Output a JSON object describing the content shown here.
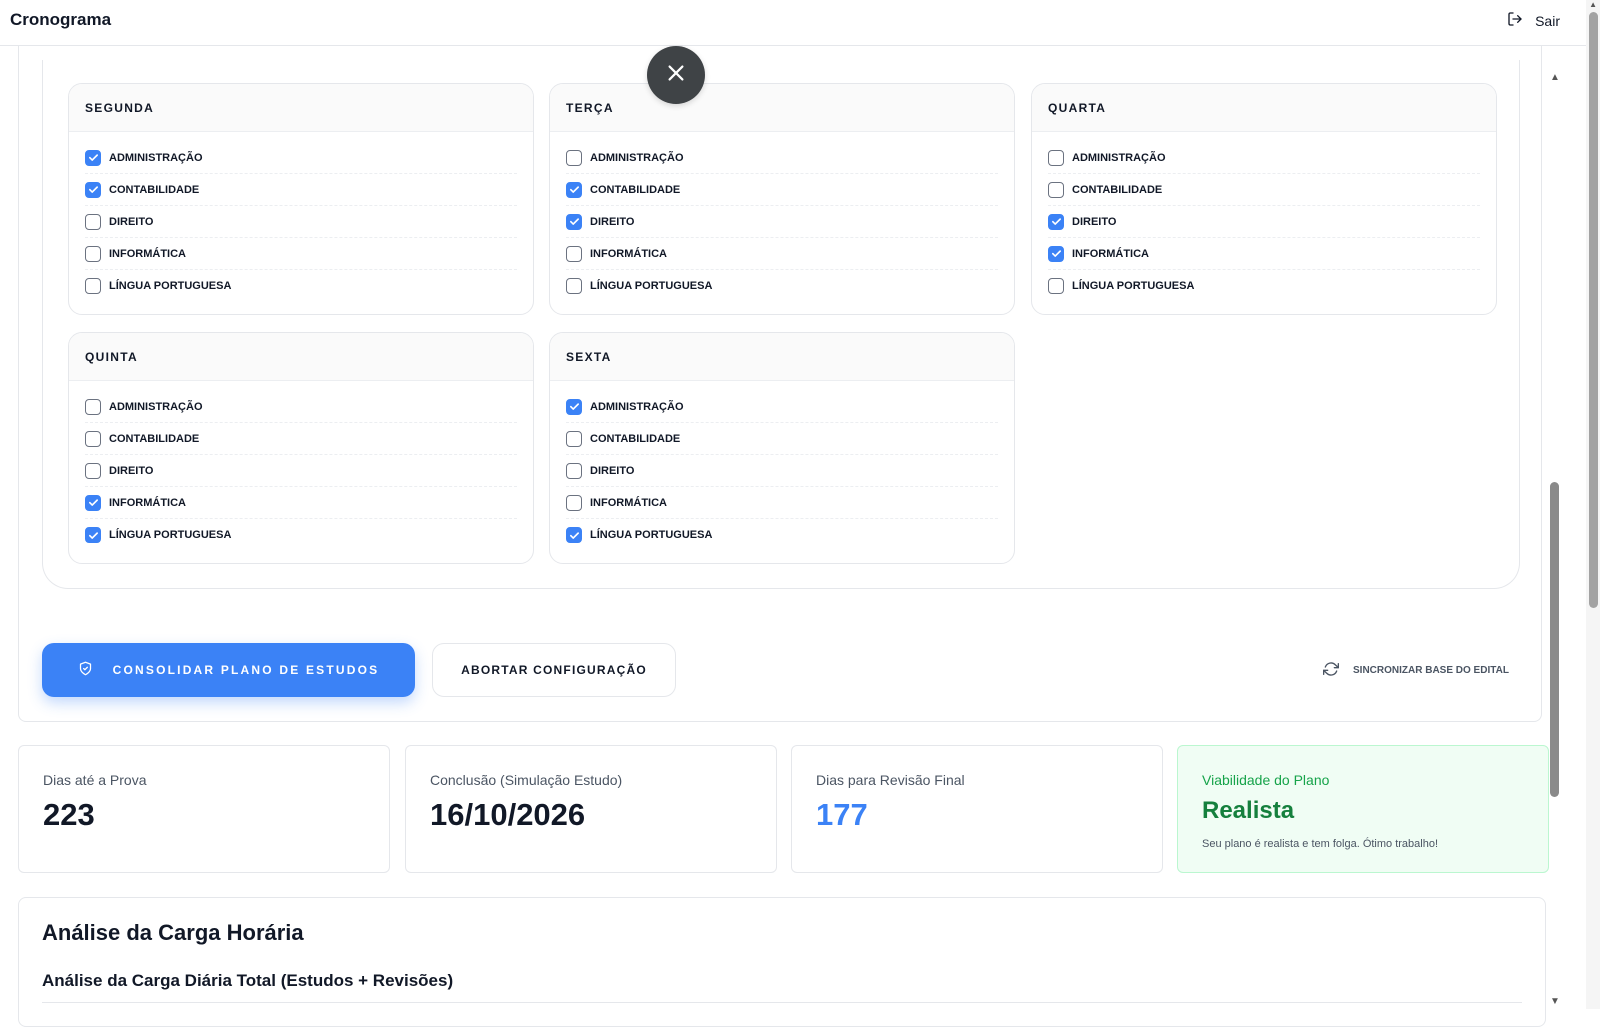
{
  "header": {
    "title": "Cronograma",
    "logout_label": "Sair"
  },
  "days": [
    {
      "name": "SEGUNDA",
      "subjects": [
        {
          "label": "ADMINISTRAÇÃO",
          "checked": true
        },
        {
          "label": "CONTABILIDADE",
          "checked": true
        },
        {
          "label": "DIREITO",
          "checked": false
        },
        {
          "label": "INFORMÁTICA",
          "checked": false
        },
        {
          "label": "LÍNGUA PORTUGUESA",
          "checked": false
        }
      ]
    },
    {
      "name": "TERÇA",
      "subjects": [
        {
          "label": "ADMINISTRAÇÃO",
          "checked": false
        },
        {
          "label": "CONTABILIDADE",
          "checked": true
        },
        {
          "label": "DIREITO",
          "checked": true
        },
        {
          "label": "INFORMÁTICA",
          "checked": false
        },
        {
          "label": "LÍNGUA PORTUGUESA",
          "checked": false
        }
      ]
    },
    {
      "name": "QUARTA",
      "subjects": [
        {
          "label": "ADMINISTRAÇÃO",
          "checked": false
        },
        {
          "label": "CONTABILIDADE",
          "checked": false
        },
        {
          "label": "DIREITO",
          "checked": true
        },
        {
          "label": "INFORMÁTICA",
          "checked": true
        },
        {
          "label": "LÍNGUA PORTUGUESA",
          "checked": false
        }
      ]
    },
    {
      "name": "QUINTA",
      "subjects": [
        {
          "label": "ADMINISTRAÇÃO",
          "checked": false
        },
        {
          "label": "CONTABILIDADE",
          "checked": false
        },
        {
          "label": "DIREITO",
          "checked": false
        },
        {
          "label": "INFORMÁTICA",
          "checked": true
        },
        {
          "label": "LÍNGUA PORTUGUESA",
          "checked": true
        }
      ]
    },
    {
      "name": "SEXTA",
      "subjects": [
        {
          "label": "ADMINISTRAÇÃO",
          "checked": true
        },
        {
          "label": "CONTABILIDADE",
          "checked": false
        },
        {
          "label": "DIREITO",
          "checked": false
        },
        {
          "label": "INFORMÁTICA",
          "checked": false
        },
        {
          "label": "LÍNGUA PORTUGUESA",
          "checked": true
        }
      ]
    }
  ],
  "actions": {
    "primary_label": "CONSOLIDAR PLANO DE ESTUDOS",
    "primary_icon": "shield-check-icon",
    "secondary_label": "ABORTAR CONFIGURAÇÃO",
    "sync_label": "SINCRONIZAR BASE DO EDITAL",
    "sync_icon": "refresh-icon",
    "close_icon": "close-icon"
  },
  "stats": [
    {
      "label": "Dias até a Prova",
      "value": "223"
    },
    {
      "label": "Conclusão (Simulação Estudo)",
      "value": "16/10/2026"
    },
    {
      "label": "Dias para Revisão Final",
      "value": "177"
    },
    {
      "label": "Viabilidade do Plano",
      "value": "Realista",
      "note": "Seu plano é realista e tem folga. Ótimo trabalho!"
    }
  ],
  "analysis": {
    "title": "Análise da Carga Horária",
    "subtitle": "Análise da Carga Diária Total (Estudos + Revisões)"
  },
  "colors": {
    "accent": "#3b82f6",
    "success": "#15803d",
    "success_bg": "#f0fdf4"
  }
}
